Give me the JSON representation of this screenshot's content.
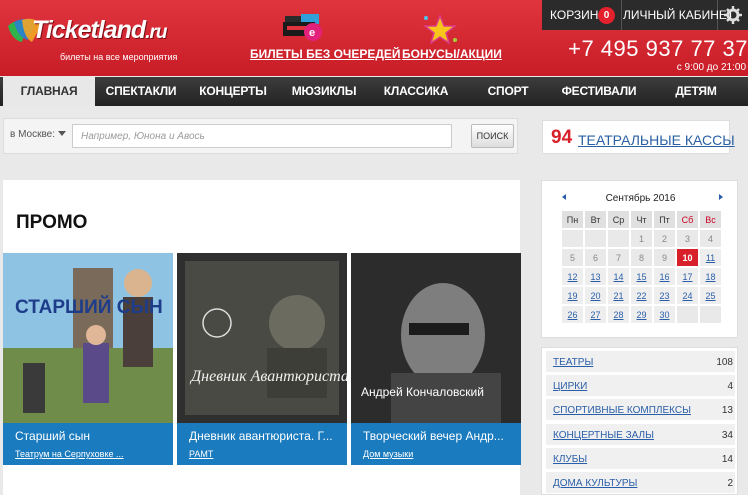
{
  "header": {
    "logo_text": "Ticketland",
    "logo_suffix": ".ru",
    "tagline": "билеты на все мероприятия",
    "no_queue_link": "БИЛЕТЫ БЕЗ ОЧЕРЕДЕЙ",
    "bonuses_link": "БОНУСЫ/АКЦИИ",
    "cart_label": "КОРЗИНА",
    "cart_count": "0",
    "cabinet_label": "ЛИЧНЫЙ КАБИНЕТ",
    "phone": "+7 495 937 77 37",
    "hours": "с 9:00 до 21:00",
    "brand_color": "#d0222c"
  },
  "nav": [
    "ГЛАВНАЯ",
    "СПЕКТАКЛИ",
    "КОНЦЕРТЫ",
    "МЮЗИКЛЫ",
    "КЛАССИКА",
    "СПОРТ",
    "ФЕСТИВАЛИ",
    "ДЕТЯМ"
  ],
  "search": {
    "city_label": "в Москве:",
    "placeholder": "Например, Юнона и Авось",
    "button": "ПОИСК"
  },
  "box_offices": {
    "count": "94",
    "label": "ТЕАТРАЛЬНЫЕ КАССЫ"
  },
  "promo": {
    "title": "ПРОМО",
    "cards": [
      {
        "title": "Старший сын",
        "venue": "Театрум на Серпуховке ...",
        "poster_text": "СТАРШИЙ СЫН"
      },
      {
        "title": "Дневник авантюриста. Г...",
        "venue": "РАМТ",
        "poster_text": "Дневник Авантюриста"
      },
      {
        "title": "Творческий вечер Андр...",
        "venue": "Дом музыки",
        "poster_text": "Андрей Кончаловский"
      }
    ]
  },
  "calendar": {
    "month": "Сентябрь 2016",
    "days_of_week": [
      "Пн",
      "Вт",
      "Ср",
      "Чт",
      "Пт",
      "Сб",
      "Вс"
    ],
    "weeks": [
      [
        "",
        "",
        "",
        "1",
        "2",
        "3",
        "4"
      ],
      [
        "5",
        "6",
        "7",
        "8",
        "9",
        "10",
        "11"
      ],
      [
        "12",
        "13",
        "14",
        "15",
        "16",
        "17",
        "18"
      ],
      [
        "19",
        "20",
        "21",
        "22",
        "23",
        "24",
        "25"
      ],
      [
        "26",
        "27",
        "28",
        "29",
        "30",
        "",
        ""
      ]
    ],
    "today": "10"
  },
  "categories": [
    {
      "name": "ТЕАТРЫ",
      "count": "108"
    },
    {
      "name": "ЦИРКИ",
      "count": "4"
    },
    {
      "name": "СПОРТИВНЫЕ КОМПЛЕКСЫ",
      "count": "13"
    },
    {
      "name": "КОНЦЕРТНЫЕ ЗАЛЫ",
      "count": "34"
    },
    {
      "name": "КЛУБЫ",
      "count": "14"
    },
    {
      "name": "ДОМА КУЛЬТУРЫ",
      "count": "2"
    }
  ]
}
